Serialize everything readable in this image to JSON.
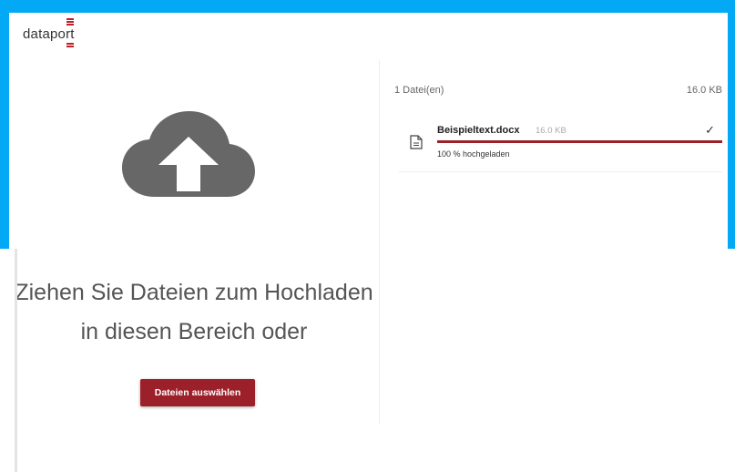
{
  "header": {
    "logo_text": "dataport"
  },
  "dropzone": {
    "line1": "Ziehen Sie Dateien zum Hochladen",
    "line2": "in diesen Bereich oder",
    "button_label": "Dateien auswählen"
  },
  "files": {
    "count_label": "1 Datei(en)",
    "total_size": "16.0 KB",
    "items": [
      {
        "name": "Beispieltext.docx",
        "size": "16.0 KB",
        "progress": 1.0,
        "status": "100 % hochgeladen",
        "icon": "document-icon",
        "done_icon": "checkmark-icon"
      }
    ]
  },
  "colors": {
    "frame": "#03a9f4",
    "accent": "#9c2029",
    "cloud": "#676767"
  }
}
